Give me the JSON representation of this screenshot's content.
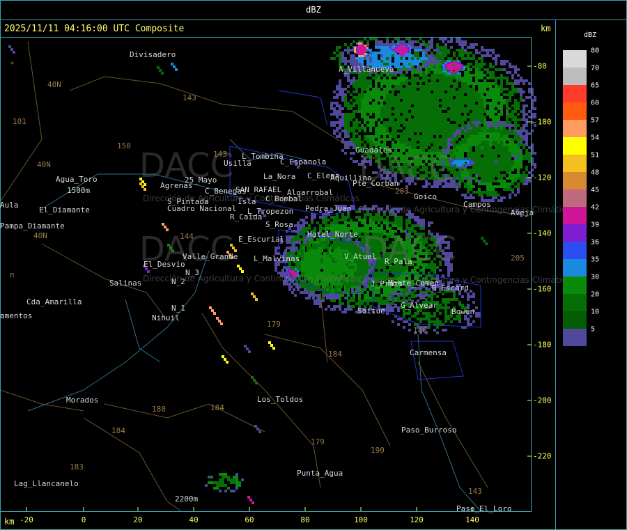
{
  "header": {
    "title": "dBZ"
  },
  "timestamp": "2025/11/11 04:16:00 UTC Composite",
  "axis_unit": "km",
  "x_ticks": [
    "-20",
    "0",
    "20",
    "40",
    "60",
    "80",
    "100",
    "120",
    "140"
  ],
  "y_ticks": [
    "-80",
    "-100",
    "-120",
    "-140",
    "-160",
    "-180",
    "-200",
    "-220"
  ],
  "legend": {
    "unit": "dBZ",
    "entries": [
      {
        "label": "80",
        "color": "#d9d9d9"
      },
      {
        "label": "70",
        "color": "#bdbdbd"
      },
      {
        "label": "65",
        "color": "#ff3b2b"
      },
      {
        "label": "60",
        "color": "#ff5a10"
      },
      {
        "label": "57",
        "color": "#ff9a60"
      },
      {
        "label": "54",
        "color": "#ffff00"
      },
      {
        "label": "51",
        "color": "#f4c020"
      },
      {
        "label": "48",
        "color": "#d88a30"
      },
      {
        "label": "45",
        "color": "#c06a80"
      },
      {
        "label": "42",
        "color": "#d0159a"
      },
      {
        "label": "39",
        "color": "#7d1fd0"
      },
      {
        "label": "36",
        "color": "#2a4ef0"
      },
      {
        "label": "35",
        "color": "#1a8ae0"
      },
      {
        "label": "30",
        "color": "#0a8a0a"
      },
      {
        "label": "20",
        "color": "#066e06"
      },
      {
        "label": "10",
        "color": "#045c04"
      },
      {
        "label": "5",
        "color": "#50489a"
      }
    ]
  },
  "places": [
    "Divisadero",
    "A_Villanueva",
    "Guadales",
    "L_Tombina",
    "Usilla",
    "C_Espanola",
    "La_Nora",
    "C_Elena",
    "Aquillino",
    "Agua_Toro",
    "Agrenas",
    "25_Mayo",
    "C_Benegas",
    "SAN_RAFAEL",
    "Algarrobal",
    "Pte_Corban",
    "Goico",
    "Campos",
    "Aveja",
    "S_Pintada",
    "Cuadro Nacional",
    "Isla",
    "C_Bombal",
    "Pedra_Juan",
    "L_Tropezon",
    "R_Caida",
    "S_Rosa",
    "Hotel_Norte",
    "E_Escurial",
    "V_Atuel",
    "R_Pala",
    "Valle_Grande",
    "L_Malvinas",
    "El_Desvio",
    "Salinas",
    "N_2",
    "N_3",
    "J_Prats",
    "Monte_Comen",
    "R_Escard",
    "G_Alvear",
    "Bowen",
    "Soitue",
    "Carmensa",
    "Cda_Amarilla",
    "N_1",
    "Nihuil",
    "Aula",
    "Pampa_Diamante",
    "El_Diamante",
    "amentos",
    "Morados",
    "Los_Toldos",
    "Paso_Burroso",
    "Punta_Agua",
    "Lag_Llancanelo",
    "Paso_El_Loro",
    "2200m",
    "1500m"
  ],
  "routes": [
    "40N",
    "40N",
    "40N",
    "101",
    "143",
    "150",
    "143",
    "144",
    "179",
    "184",
    "180",
    "184",
    "184",
    "183",
    "179",
    "190",
    "203",
    "205",
    "143",
    "146",
    "n",
    "*"
  ],
  "watermark": {
    "brand": "DACC",
    "caption": "Dirección de Agricultura y Contingencias Climáticas"
  }
}
